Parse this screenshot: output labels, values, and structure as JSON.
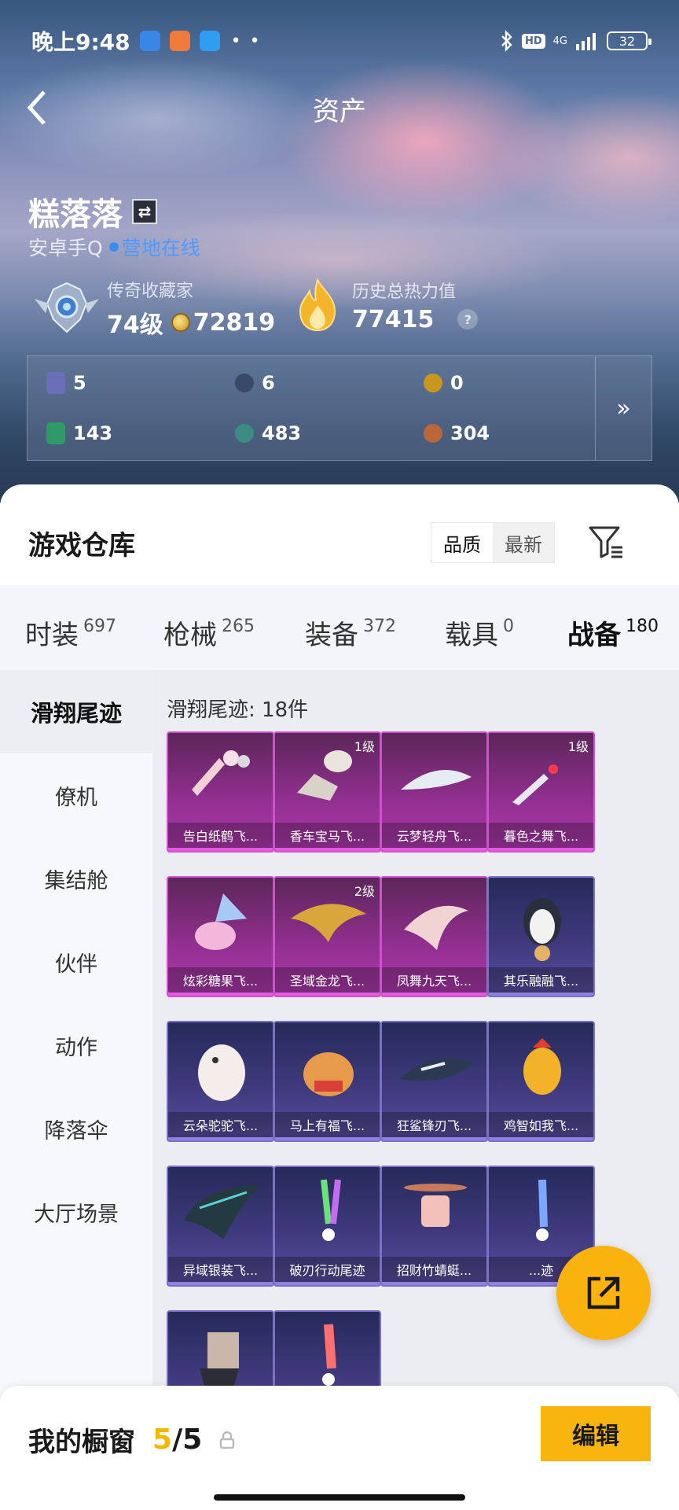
{
  "status_bar": {
    "time": "晚上9:48",
    "hd": "HD",
    "network": "4G",
    "battery": "32"
  },
  "nav": {
    "title": "资产"
  },
  "player": {
    "name": "糕落落",
    "platform": "安卓手Q",
    "status": "营地在线"
  },
  "rank": {
    "title": "传奇收藏家",
    "level": "74级",
    "coins": "72819"
  },
  "heat": {
    "title": "历史总热力值",
    "value": "77415",
    "help": "?"
  },
  "stats": [
    {
      "icon": "card-icon",
      "value": "5",
      "color": "#6a6fb8"
    },
    {
      "icon": "dark-orb-icon",
      "value": "6",
      "color": "#3a4a66"
    },
    {
      "icon": "gold-coin-icon",
      "value": "0",
      "color": "#c9971c"
    },
    {
      "icon": "green-card-icon",
      "value": "143",
      "color": "#2f9a68"
    },
    {
      "icon": "teal-orb-icon",
      "value": "483",
      "color": "#3d8c82"
    },
    {
      "icon": "copper-coin-icon",
      "value": "304",
      "color": "#b8663a"
    }
  ],
  "stats_more": "»",
  "warehouse": {
    "title": "游戏仓库",
    "sort_quality": "品质",
    "sort_newest": "最新"
  },
  "tabs": [
    {
      "label": "时装",
      "count": "697"
    },
    {
      "label": "枪械",
      "count": "265"
    },
    {
      "label": "装备",
      "count": "372"
    },
    {
      "label": "载具",
      "count": "0"
    },
    {
      "label": "战备",
      "count": "180"
    }
  ],
  "sidebar": [
    {
      "label": "滑翔尾迹"
    },
    {
      "label": "僚机"
    },
    {
      "label": "集结舱"
    },
    {
      "label": "伙伴"
    },
    {
      "label": "动作"
    },
    {
      "label": "降落伞"
    },
    {
      "label": "大厅场景"
    }
  ],
  "section_title": "滑翔尾迹: 18件",
  "items": [
    {
      "name": "告白纸鹤飞...",
      "level": "",
      "rarity": "purple"
    },
    {
      "name": "香车宝马飞...",
      "level": "1级",
      "rarity": "purple"
    },
    {
      "name": "云梦轻舟飞...",
      "level": "",
      "rarity": "purple"
    },
    {
      "name": "暮色之舞飞...",
      "level": "1级",
      "rarity": "purple"
    },
    {
      "name": "炫彩糖果飞...",
      "level": "",
      "rarity": "purple"
    },
    {
      "name": "圣域金龙飞...",
      "level": "2级",
      "rarity": "purple"
    },
    {
      "name": "凤舞九天飞...",
      "level": "",
      "rarity": "purple"
    },
    {
      "name": "其乐融融飞...",
      "level": "",
      "rarity": "indigo"
    },
    {
      "name": "云朵驼驼飞...",
      "level": "",
      "rarity": "indigo"
    },
    {
      "name": "马上有福飞...",
      "level": "",
      "rarity": "indigo"
    },
    {
      "name": "狂鲨锋刃飞...",
      "level": "",
      "rarity": "indigo"
    },
    {
      "name": "鸡智如我飞...",
      "level": "",
      "rarity": "indigo"
    },
    {
      "name": "异域银装飞...",
      "level": "",
      "rarity": "indigo"
    },
    {
      "name": "破刃行动尾迹",
      "level": "",
      "rarity": "indigo"
    },
    {
      "name": "招财竹蜻蜓...",
      "level": "",
      "rarity": "indigo"
    },
    {
      "name": "...迹",
      "level": "",
      "rarity": "indigo"
    },
    {
      "name": "",
      "level": "",
      "rarity": "indigo"
    },
    {
      "name": "",
      "level": "",
      "rarity": "indigo"
    }
  ],
  "showcase": {
    "label": "我的橱窗",
    "current": "5",
    "separator": "/",
    "total": "5"
  },
  "edit_button": "编辑",
  "accent_color": "#f7b50e"
}
